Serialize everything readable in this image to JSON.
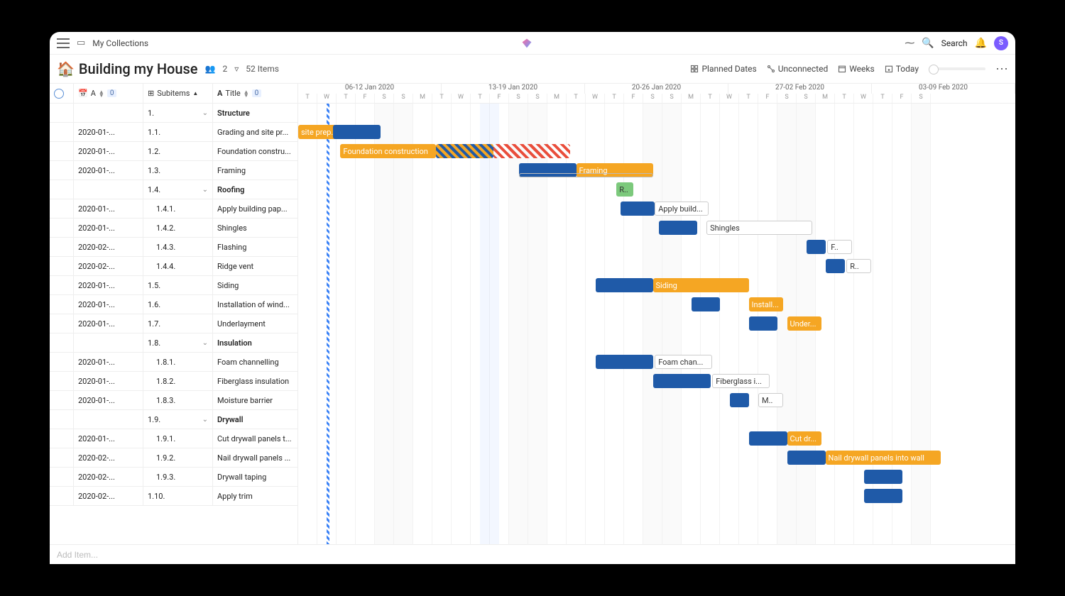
{
  "topbar": {
    "breadcrumb": "My Collections",
    "search_label": "Search",
    "avatar_initial": "S"
  },
  "header": {
    "title": "Building my House",
    "people_count": "2",
    "item_count": "52 Items",
    "planned_dates": "Planned Dates",
    "unconnected": "Unconnected",
    "weeks": "Weeks",
    "today": "Today"
  },
  "columns": {
    "date_label": "A",
    "date_badge": "0",
    "subitems_label": "Subitems",
    "title_label": "Title",
    "title_badge": "0"
  },
  "weeks": [
    "06-12 Jan 2020",
    "13-19 Jan 2020",
    "20-26 Jan 2020",
    "27-02 Feb 2020",
    "03-09 Feb 2020"
  ],
  "days": "TWTFSSMTWTFSSMTWTFSSMTWTFSSMTWTFS",
  "rows": [
    {
      "date": "",
      "num": "1.",
      "title": "Structure",
      "bold": true,
      "expand": true
    },
    {
      "date": "2020-01-...",
      "num": "1.1.",
      "title": "Grading and site pr...",
      "bold": false
    },
    {
      "date": "2020-01-...",
      "num": "1.2.",
      "title": "Foundation constru...",
      "bold": false
    },
    {
      "date": "2020-01-...",
      "num": "1.3.",
      "title": "Framing",
      "bold": false
    },
    {
      "date": "",
      "num": "1.4.",
      "title": "Roofing",
      "bold": true,
      "expand": true
    },
    {
      "date": "2020-01-...",
      "num": "1.4.1.",
      "title": "Apply building pap...",
      "bold": false
    },
    {
      "date": "2020-01-...",
      "num": "1.4.2.",
      "title": "Shingles",
      "bold": false
    },
    {
      "date": "2020-02-...",
      "num": "1.4.3.",
      "title": "Flashing",
      "bold": false
    },
    {
      "date": "2020-02-...",
      "num": "1.4.4.",
      "title": "Ridge vent",
      "bold": false
    },
    {
      "date": "2020-01-...",
      "num": "1.5.",
      "title": "Siding",
      "bold": false
    },
    {
      "date": "2020-01-...",
      "num": "1.6.",
      "title": "Installation of wind...",
      "bold": false
    },
    {
      "date": "2020-01-...",
      "num": "1.7.",
      "title": "Underlayment",
      "bold": false
    },
    {
      "date": "",
      "num": "1.8.",
      "title": "Insulation",
      "bold": true,
      "expand": true
    },
    {
      "date": "2020-01-...",
      "num": "1.8.1.",
      "title": "Foam channelling",
      "bold": false
    },
    {
      "date": "2020-01-...",
      "num": "1.8.2.",
      "title": "Fiberglass insulation",
      "bold": false
    },
    {
      "date": "2020-01-...",
      "num": "1.8.3.",
      "title": "Moisture barrier",
      "bold": false
    },
    {
      "date": "",
      "num": "1.9.",
      "title": "Drywall",
      "bold": true,
      "expand": true
    },
    {
      "date": "2020-01-...",
      "num": "1.9.1.",
      "title": "Cut drywall panels t...",
      "bold": false
    },
    {
      "date": "2020-02-...",
      "num": "1.9.2.",
      "title": "Nail drywall panels ...",
      "bold": false
    },
    {
      "date": "2020-02-...",
      "num": "1.9.3.",
      "title": "Drywall taping",
      "bold": false
    },
    {
      "date": "2020-02-...",
      "num": "1.10.",
      "title": "Apply trim",
      "bold": false
    }
  ],
  "bars": {
    "grading_planned": "site prep...",
    "foundation_planned": "Foundation construction",
    "framing": "Framing",
    "roofing": "R..",
    "apply_build": "Apply build...",
    "shingles": "Shingles",
    "flashing": "F..",
    "ridge": "R..",
    "siding": "Siding",
    "install": "Install...",
    "under": "Under...",
    "foam": "Foam chan...",
    "fiberglass": "Fiberglass i...",
    "moisture": "M..",
    "cutdry": "Cut dr...",
    "naildry": "Nail drywall panels into wall",
    "drywall_taping": ""
  },
  "footer": {
    "add_placeholder": "Add Item..."
  }
}
